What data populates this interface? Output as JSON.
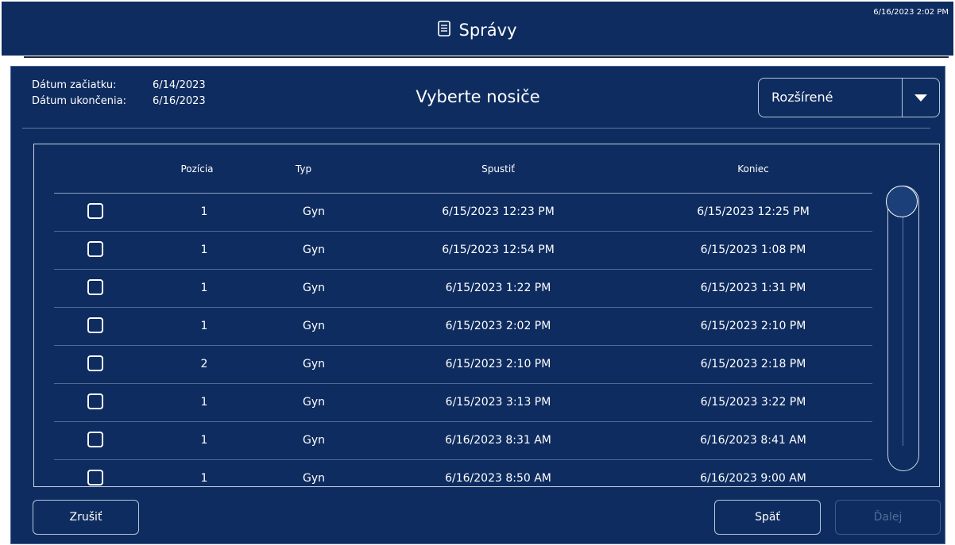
{
  "header": {
    "title": "Správy",
    "title_icon": "document-icon",
    "clock": "6/16/2023 2:02 PM"
  },
  "dates": {
    "start_label": "Dátum začiatku:",
    "start_value": "6/14/2023",
    "end_label": "Dátum ukončenia:",
    "end_value": "6/16/2023"
  },
  "page_title": "Vyberte nosiče",
  "dropdown": {
    "value": "Rozšírené",
    "icon": "chevron-down-icon"
  },
  "table": {
    "columns": [
      "Pozícia",
      "Typ",
      "Spustiť",
      "Koniec"
    ],
    "rows": [
      {
        "checked": false,
        "position": "1",
        "type": "Gyn",
        "start": "6/15/2023 12:23 PM",
        "end": "6/15/2023 12:25 PM"
      },
      {
        "checked": false,
        "position": "1",
        "type": "Gyn",
        "start": "6/15/2023 12:54 PM",
        "end": "6/15/2023 1:08 PM"
      },
      {
        "checked": false,
        "position": "1",
        "type": "Gyn",
        "start": "6/15/2023 1:22 PM",
        "end": "6/15/2023 1:31 PM"
      },
      {
        "checked": false,
        "position": "1",
        "type": "Gyn",
        "start": "6/15/2023 2:02 PM",
        "end": "6/15/2023 2:10 PM"
      },
      {
        "checked": false,
        "position": "2",
        "type": "Gyn",
        "start": "6/15/2023 2:10 PM",
        "end": "6/15/2023 2:18 PM"
      },
      {
        "checked": false,
        "position": "1",
        "type": "Gyn",
        "start": "6/15/2023 3:13 PM",
        "end": "6/15/2023 3:22 PM"
      },
      {
        "checked": false,
        "position": "1",
        "type": "Gyn",
        "start": "6/16/2023 8:31 AM",
        "end": "6/16/2023 8:41 AM"
      },
      {
        "checked": false,
        "position": "1",
        "type": "Gyn",
        "start": "6/16/2023 8:50 AM",
        "end": "6/16/2023 9:00 AM"
      }
    ]
  },
  "buttons": {
    "cancel": "Zrušiť",
    "back": "Späť",
    "next": "Ďalej"
  },
  "colors": {
    "background": "#0e2c5f",
    "border": "#b8c6dc",
    "disabled": "#4f6e9a"
  }
}
